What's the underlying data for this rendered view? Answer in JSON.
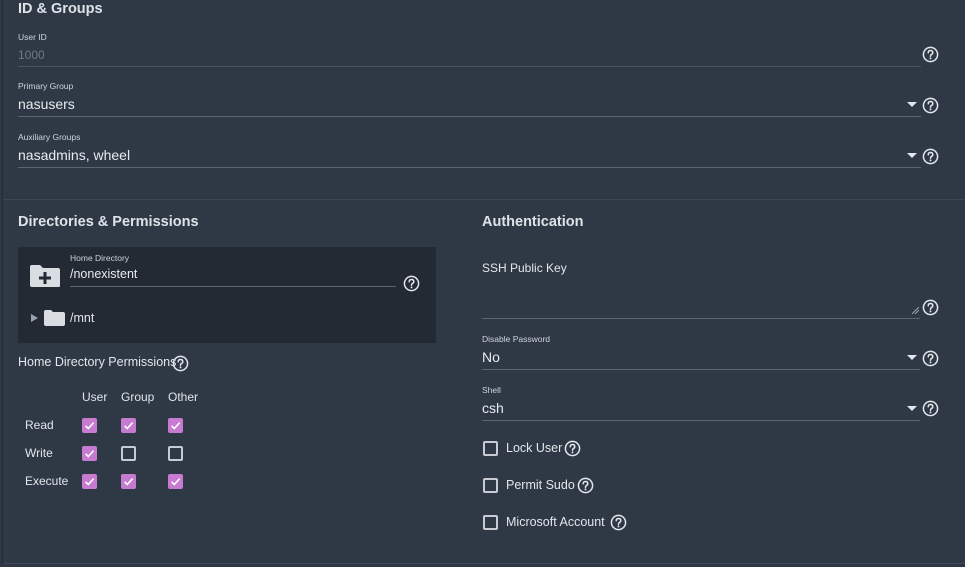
{
  "id_groups": {
    "title": "ID & Groups",
    "user_id": {
      "label": "User ID",
      "value": "1000"
    },
    "primary_group": {
      "label": "Primary Group",
      "value": "nasusers"
    },
    "auxiliary_groups": {
      "label": "Auxiliary Groups",
      "value": "nasadmins, wheel"
    }
  },
  "directories": {
    "title": "Directories & Permissions",
    "home_directory": {
      "label": "Home Directory",
      "value": "/nonexistent"
    },
    "tree_root": "/mnt",
    "permissions_label": "Home Directory Permissions",
    "columns": [
      "User",
      "Group",
      "Other"
    ],
    "rows": [
      {
        "label": "Read",
        "checks": [
          true,
          true,
          true
        ]
      },
      {
        "label": "Write",
        "checks": [
          true,
          false,
          false
        ]
      },
      {
        "label": "Execute",
        "checks": [
          true,
          true,
          true
        ]
      }
    ]
  },
  "authentication": {
    "title": "Authentication",
    "ssh_key": {
      "label": "SSH Public Key",
      "value": ""
    },
    "disable_password": {
      "label": "Disable Password",
      "value": "No"
    },
    "shell": {
      "label": "Shell",
      "value": "csh"
    },
    "options": [
      {
        "label": "Lock User",
        "checked": false
      },
      {
        "label": "Permit Sudo",
        "checked": false
      },
      {
        "label": "Microsoft Account",
        "checked": false
      }
    ]
  },
  "colors": {
    "accent": "#c67ad0",
    "background": "#2f3946",
    "panel": "#232a34"
  },
  "icons": [
    "help-icon",
    "caret-down-icon",
    "folder-add-icon",
    "folder-icon",
    "expand-arrow-icon",
    "check-icon"
  ]
}
